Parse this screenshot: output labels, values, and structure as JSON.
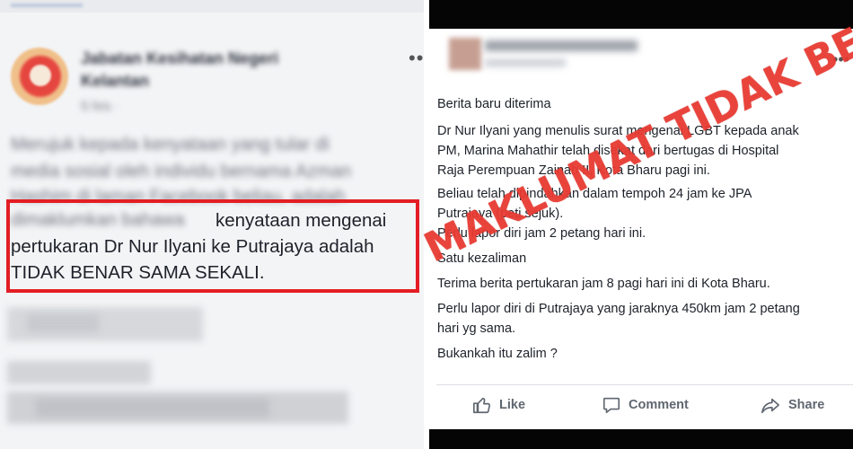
{
  "left_post": {
    "author_blurred": "Jabatan Kesihatan Negeri Kelantan",
    "author_line1": "Jabatan Kesihatan Negeri",
    "author_line2": "Kelantan",
    "time_blurred": "5 hrs · ",
    "body_blurred": [
      "Merujuk kepada kenyataan yang tular di",
      "media sosial oleh individu bernama Azman",
      "Hashim di laman Facebook beliau, adalah",
      "dimaklumkan bahawa"
    ],
    "highlighted_lines": [
      "kenyataan mengenai",
      "pertukaran Dr Nur Ilyani ke Putrajaya adalah",
      "TIDAK BENAR SAMA SEKALI."
    ],
    "more_label": "•••"
  },
  "right_post": {
    "more_label": "•••",
    "lines": [
      "Berita baru diterima",
      "Dr Nur Ilyani yang menulis surat mengenai LGBT kepada anak",
      "PM, Marina Mahathir telah disekat dari bertugas di Hospital",
      "Raja Perempuan Zainab II, Kota Bharu pagi ini.",
      "Beliau telah dipindahkan dalam tempoh 24 jam ke JPA",
      "Putrajaya (peti sejuk).",
      "Perlu lapor diri jam 2 petang hari ini.",
      "Satu kezaliman",
      "Terima berita pertukaran jam 8 pagi hari ini di Kota Bharu.",
      "Perlu lapor diri di Putrajaya yang jaraknya 450km jam 2 petang",
      "hari yg sama.",
      "Bukankah itu zalim ?"
    ],
    "actions": {
      "like": "Like",
      "comment": "Comment",
      "share": "Share"
    },
    "action_icons": [
      "thumbs-up-icon",
      "comment-icon",
      "share-icon"
    ]
  },
  "stamp": {
    "text": "MAKLUMAT TIDAK BENAR",
    "color": "#e83a32"
  },
  "colors": {
    "highlight_border": "#e31e24",
    "action_text": "#606770"
  }
}
